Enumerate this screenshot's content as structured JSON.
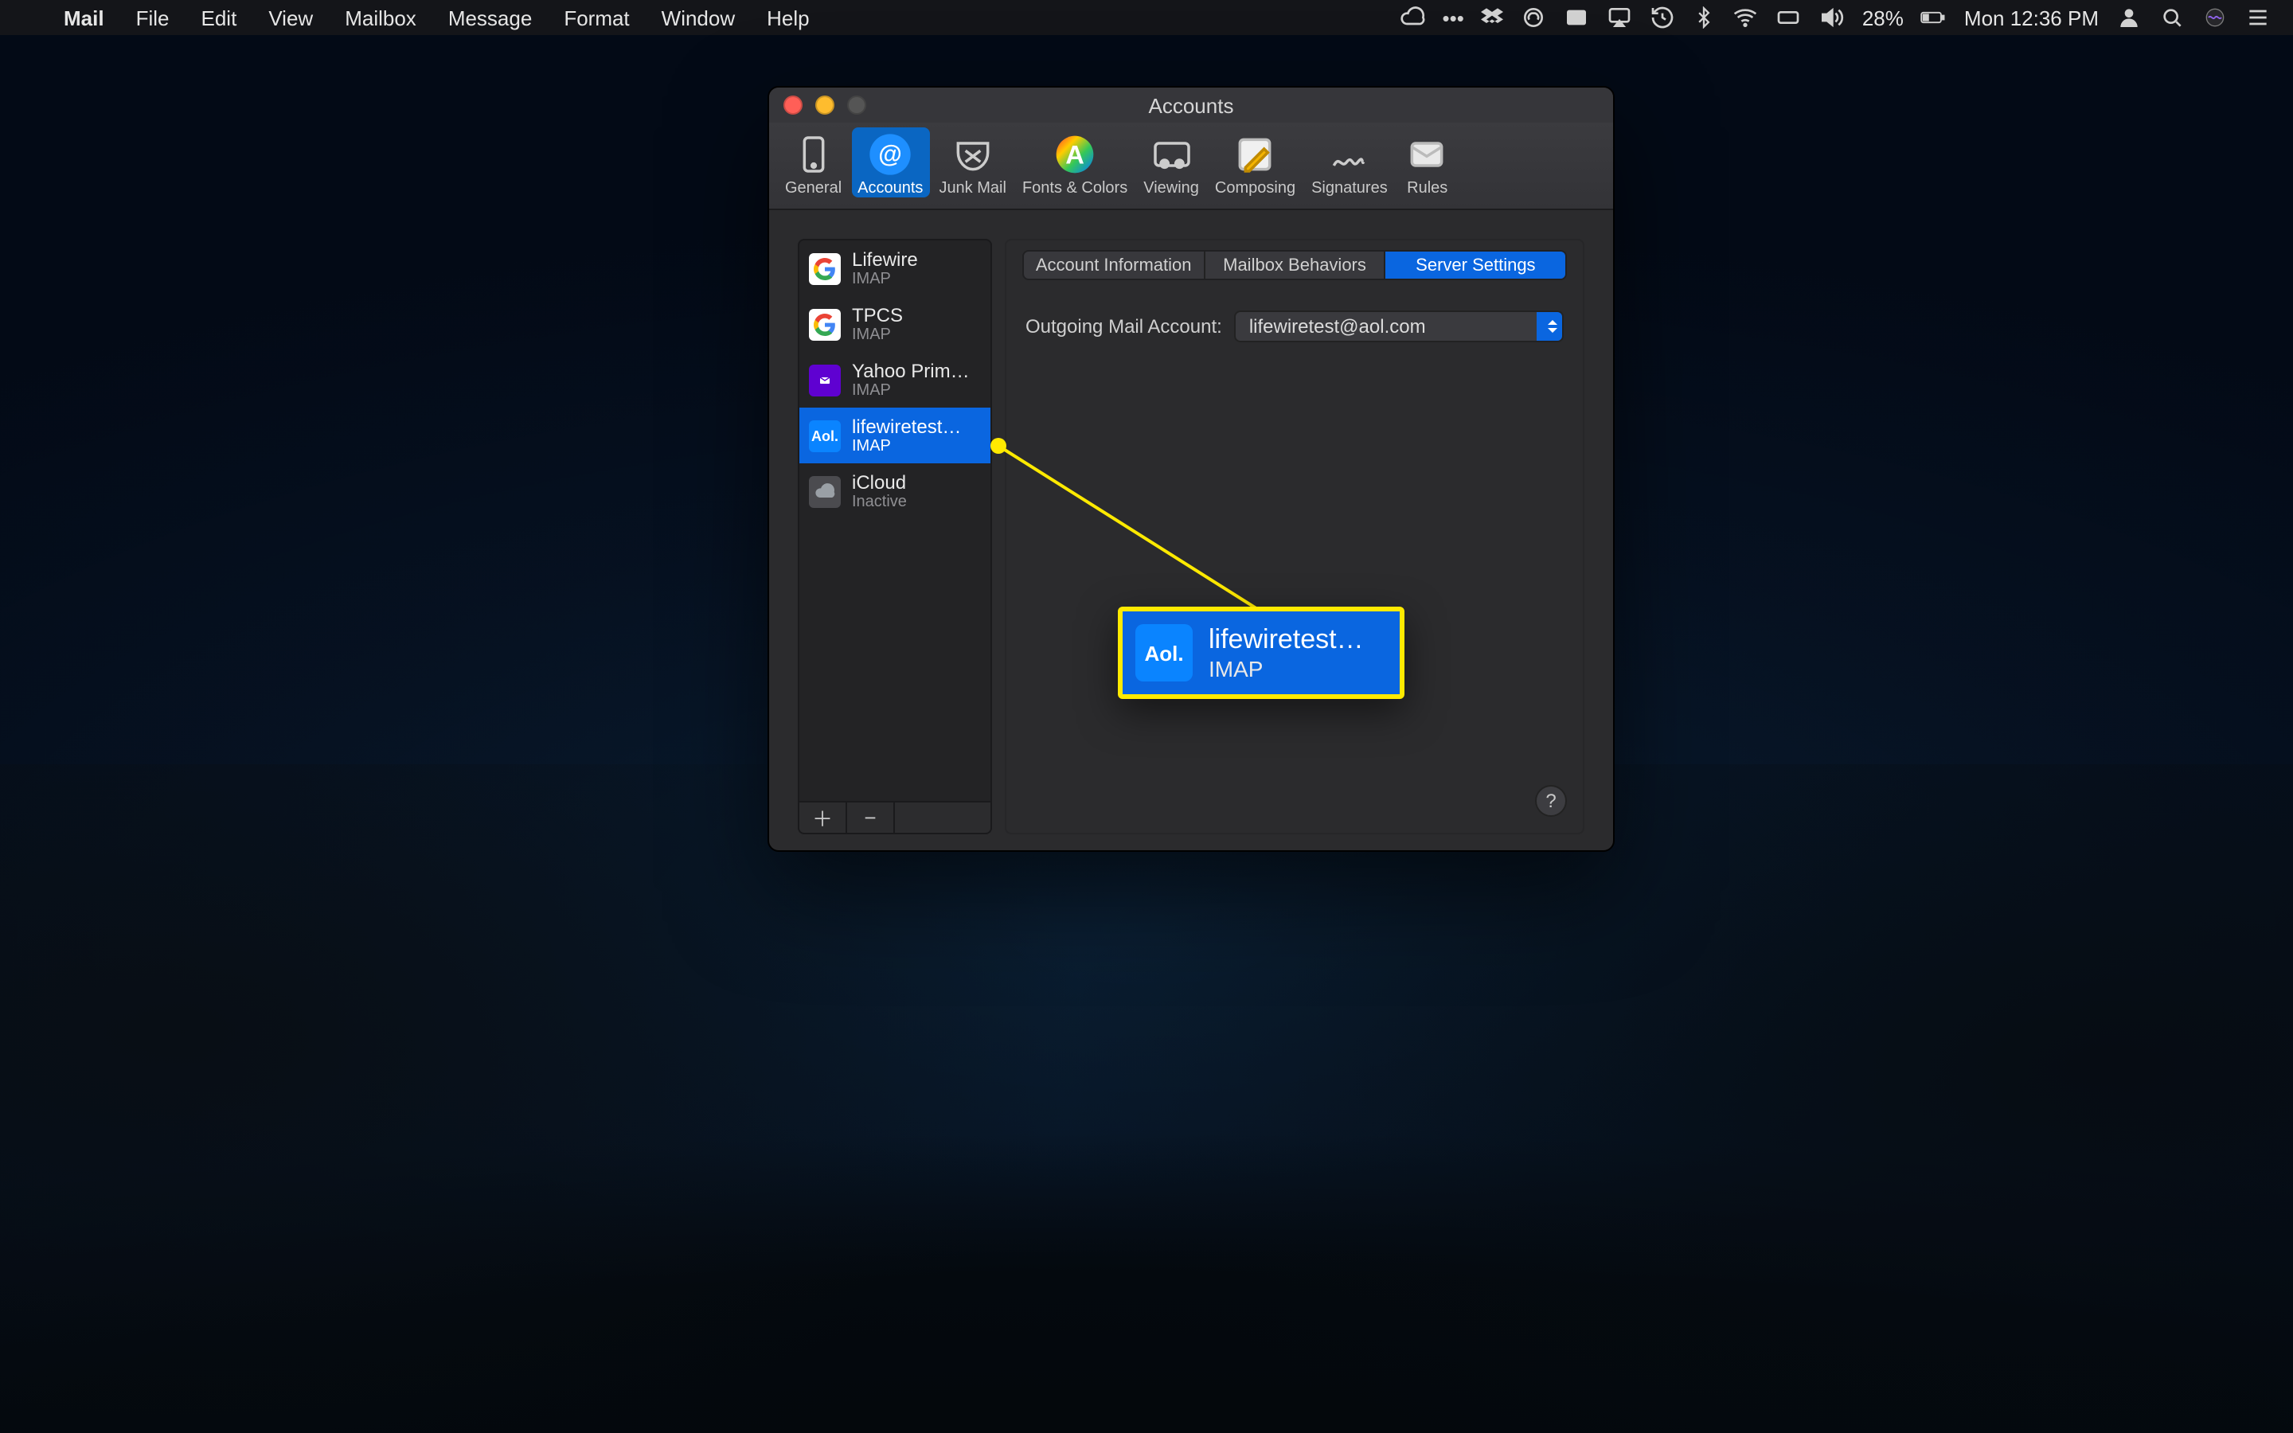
{
  "menubar": {
    "app": "Mail",
    "items": [
      "File",
      "Edit",
      "View",
      "Mailbox",
      "Message",
      "Format",
      "Window",
      "Help"
    ],
    "battery": "28%",
    "clock": "Mon 12:36 PM"
  },
  "window": {
    "title": "Accounts",
    "toolbar": [
      {
        "id": "general",
        "label": "General"
      },
      {
        "id": "accounts",
        "label": "Accounts",
        "selected": true
      },
      {
        "id": "junk",
        "label": "Junk Mail"
      },
      {
        "id": "fonts",
        "label": "Fonts & Colors"
      },
      {
        "id": "viewing",
        "label": "Viewing"
      },
      {
        "id": "composing",
        "label": "Composing"
      },
      {
        "id": "signatures",
        "label": "Signatures"
      },
      {
        "id": "rules",
        "label": "Rules"
      }
    ],
    "accounts": [
      {
        "name": "Lifewire",
        "type": "IMAP",
        "provider": "google"
      },
      {
        "name": "TPCS",
        "type": "IMAP",
        "provider": "google"
      },
      {
        "name": "Yahoo Prim…",
        "type": "IMAP",
        "provider": "yahoo"
      },
      {
        "name": "lifewiretest…",
        "type": "IMAP",
        "provider": "aol",
        "selected": true
      },
      {
        "name": "iCloud",
        "type": "Inactive",
        "provider": "icloud"
      }
    ],
    "tabs": [
      {
        "label": "Account Information"
      },
      {
        "label": "Mailbox Behaviors"
      },
      {
        "label": "Server Settings",
        "selected": true
      }
    ],
    "outgoing_label": "Outgoing Mail Account:",
    "outgoing_value": "lifewiretest@aol.com",
    "help": "?"
  },
  "callout": {
    "name": "lifewiretest…",
    "type": "IMAP",
    "icon": "Aol."
  },
  "icons": {
    "aol": "Aol."
  }
}
